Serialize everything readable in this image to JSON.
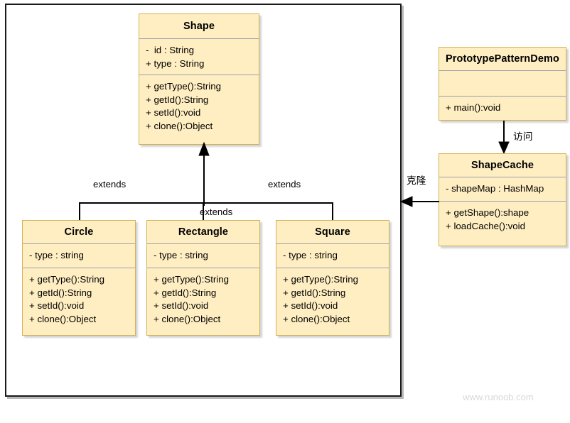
{
  "diagram": {
    "title_watermark": "www.runoob.com",
    "colors": {
      "box_fill": "#ffeec2",
      "box_border": "#d4b158",
      "frame_border": "#1a1a1a",
      "separator": "#9aa0ab",
      "text": "#000000",
      "watermark": "#d8d8d8"
    },
    "classes": {
      "shape": {
        "name": "Shape",
        "attributes": [
          "-  id : String",
          "+ type : String"
        ],
        "methods": [
          "+ getType():String",
          "+ getId():String",
          "+ setId():void",
          "+ clone():Object"
        ]
      },
      "circle": {
        "name": "Circle",
        "attributes": [
          "- type : string"
        ],
        "methods": [
          "+ getType():String",
          "+ getId():String",
          "+ setId():void",
          "+ clone():Object"
        ]
      },
      "rectangle": {
        "name": "Rectangle",
        "attributes": [
          "- type : string"
        ],
        "methods": [
          "+ getType():String",
          "+ getId():String",
          "+ setId():void",
          "+ clone():Object"
        ]
      },
      "square": {
        "name": "Square",
        "attributes": [
          "- type : string"
        ],
        "methods": [
          "+ getType():String",
          "+ getId():String",
          "+ setId():void",
          "+ clone():Object"
        ]
      },
      "prototype_pattern_demo": {
        "name": "PrototypePatternDemo",
        "attributes": [],
        "methods": [
          "+ main():void"
        ]
      },
      "shape_cache": {
        "name": "ShapeCache",
        "attributes": [
          "- shapeMap : HashMap"
        ],
        "methods": [
          "+ getShape():shape",
          "+ loadCache():void"
        ]
      }
    },
    "relations": {
      "extends_circle": "extends",
      "extends_rectangle": "extends",
      "extends_square": "extends",
      "demo_to_cache": "访问",
      "cache_to_shapes": "克隆"
    }
  }
}
